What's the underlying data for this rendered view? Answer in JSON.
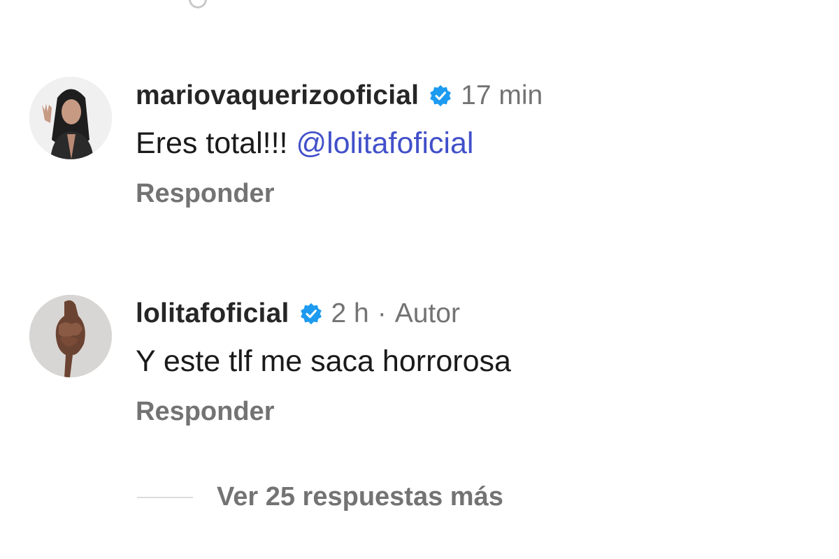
{
  "comments": [
    {
      "username": "mariovaquerizooficial",
      "time": "17 min",
      "text": "Eres total!!! ",
      "mention": "@lolitafoficial",
      "reply_label": "Responder",
      "avatar_icon": "profile-photo"
    },
    {
      "username": "lolitafoficial",
      "time": "2 h",
      "separator": "·",
      "author_tag": "Autor",
      "text": "Y este tlf me saca horrorosa",
      "reply_label": "Responder",
      "avatar_icon": "profile-photo"
    }
  ],
  "more_replies_label": "Ver 25 respuestas más",
  "colors": {
    "verified_badge": "#1d9bf0",
    "mention": "#4150c9",
    "secondary_text": "#737373"
  }
}
